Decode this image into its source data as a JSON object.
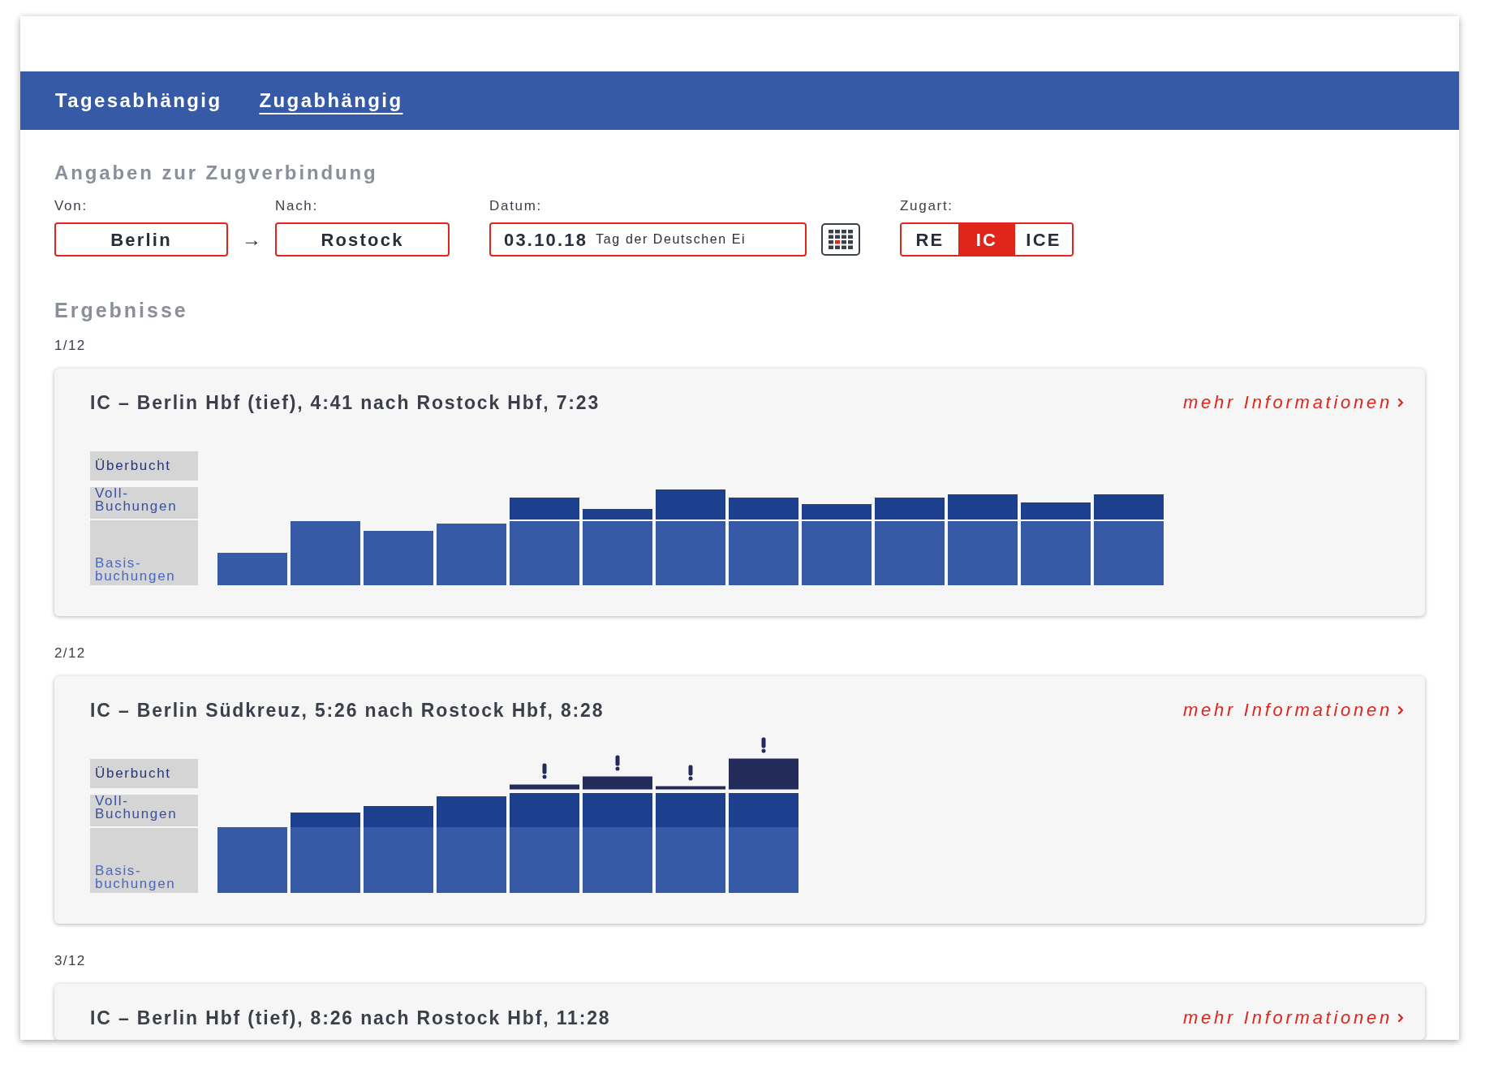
{
  "nav": {
    "tabs": [
      {
        "label": "Tagesabhängig",
        "selected": false
      },
      {
        "label": "Zugabhängig",
        "selected": true
      }
    ]
  },
  "connection_form": {
    "heading": "Angaben zur Zugverbindung",
    "from": {
      "label": "Von:",
      "value": "Berlin"
    },
    "separator": "→",
    "to": {
      "label": "Nach:",
      "value": "Rostock"
    },
    "date": {
      "label": "Datum:",
      "value": "03.10.18",
      "holiday": "Tag der Deutschen Ei"
    },
    "train_type": {
      "label": "Zugart:",
      "options": [
        {
          "label": "RE",
          "selected": false
        },
        {
          "label": "IC",
          "selected": true
        },
        {
          "label": "ICE",
          "selected": false
        }
      ]
    }
  },
  "results": {
    "heading": "Ergebnisse",
    "items": [
      {
        "position": "1/12",
        "title": "IC – Berlin Hbf (tief), 4:41 nach Rostock Hbf, 7:23",
        "link": "mehr Informationen",
        "legend": [
          "Überbucht",
          "Voll-Buchungen",
          "Basis-buchungen"
        ]
      },
      {
        "position": "2/12",
        "title": "IC – Berlin Südkreuz, 5:26 nach Rostock Hbf, 8:28",
        "link": "mehr Informationen",
        "legend": [
          "Überbucht",
          "Voll-Buchungen",
          "Basis-buchungen"
        ]
      },
      {
        "position": "3/12",
        "title": "IC – Berlin Hbf (tief), 8:26 nach Rostock Hbf, 11:28",
        "link": "mehr Informationen"
      }
    ]
  }
}
